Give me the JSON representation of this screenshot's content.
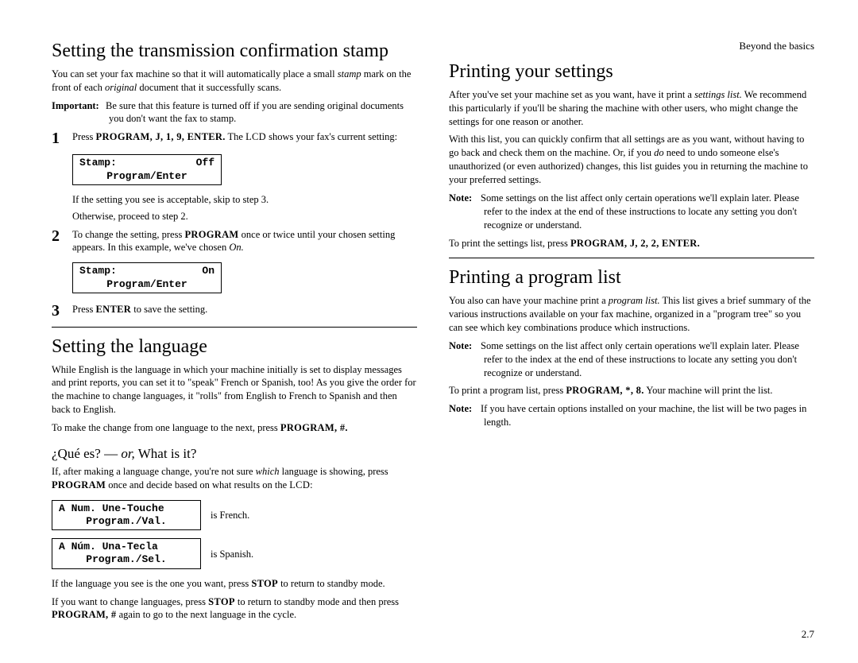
{
  "runningHead": "Beyond the basics",
  "pageNumber": "2.7",
  "left": {
    "h1a": "Setting the transmission confirmation stamp",
    "intro": {
      "pre": "You can set your fax machine so that it will automatically place a small ",
      "em": "stamp",
      "post1": " mark on the front of each ",
      "em2": "original",
      "post2": " document that it successfully scans."
    },
    "important": {
      "label": "Important:",
      "text": "Be sure that this feature is turned off if you are sending original documents you don't want the fax to stamp."
    },
    "step1": {
      "pre": "Press ",
      "keys": "PROGRAM, J, 1, 9, ENTER.",
      "mid": " The ",
      "lcd": "LCD",
      "post": " shows your fax's current setting:"
    },
    "lcd1": {
      "l1a": "Stamp:",
      "l1b": "Off",
      "l2": "Program/Enter"
    },
    "postLcd1a": "If the setting you see is acceptable, skip to step 3.",
    "postLcd1b": "Otherwise, proceed to step 2.",
    "step2": {
      "pre": "To change the setting, press ",
      "key": "PROGRAM",
      "mid": " once or twice until your chosen setting appears. In this example, we've chosen ",
      "em": "On.",
      "post": ""
    },
    "lcd2": {
      "l1a": "Stamp:",
      "l1b": "On",
      "l2": "Program/Enter"
    },
    "step3": {
      "pre": "Press ",
      "key": "ENTER",
      "post": " to save the setting."
    },
    "h1b": "Setting the language",
    "langIntro": "While English is the language in which your machine initially is set to display messages and print reports, you can set it to \"speak\" French or Spanish, too! As you give the order for the machine to change languages, it \"rolls\" from English to French to Spanish and then back to English.",
    "langMake": {
      "pre": "To make the change from one language to the next, press ",
      "key": "PROGRAM, #."
    },
    "h2": "¿Qué es? — ",
    "h2em": "or,",
    "h2post": " What is it?",
    "que1": {
      "pre": "If, after making a language change, you're not sure ",
      "em": "which",
      "mid": " language is showing, press ",
      "key": "PROGRAM",
      "post1": " once and decide based on what results on the ",
      "lcd": "LCD",
      "post2": ":"
    },
    "lcdFr": {
      "l1": "A Num. Une-Touche",
      "l2": "Program./Val."
    },
    "frIs": "is French.",
    "lcdEs": {
      "l1": "A Núm. Una-Tecla",
      "l2": "Program./Sel."
    },
    "esIs": "is Spanish.",
    "lang3": {
      "pre": "If the language you see is the one you want, press ",
      "key": "STOP",
      "post": " to return to standby mode."
    },
    "lang4": {
      "pre": "If you want to change languages, press ",
      "key1": "STOP",
      "mid": " to return to standby mode and then press ",
      "key2": "PROGRAM, #",
      "post": " again to go to the next language in the cycle."
    }
  },
  "right": {
    "h1a": "Printing your settings",
    "p1": {
      "pre": "After you've set your machine set as you want, have it print a ",
      "em": "settings list.",
      "post": " We recommend this particularly if you'll be sharing the machine with other users, who might change the settings for one reason or another."
    },
    "p2": {
      "pre": "With this list, you can quickly confirm that all settings are as you want, without having to go back and check them on the machine. Or, if you ",
      "em": "do",
      "post": " need to undo someone else's unauthorized (or even authorized) changes, this list guides you in returning the machine to your preferred settings."
    },
    "note1": {
      "label": "Note:",
      "text": "Some settings on the list affect only certain operations we'll explain later. Please refer to the index at the end of these instructions to locate any setting you don't recognize or understand."
    },
    "p3": {
      "pre": "To print the settings list, press ",
      "key": "PROGRAM, J, 2, 2, ENTER."
    },
    "h1b": "Printing a program list",
    "pl1": {
      "pre": "You also can have your machine print a ",
      "em": "program list.",
      "post": " This list gives a brief summary of the various instructions available on your fax machine, organized in a \"program tree\" so you can see which key combinations produce which instructions."
    },
    "note2": {
      "label": "Note:",
      "text": "Some settings on the list affect only certain operations we'll explain later. Please refer to the index at the end of these instructions to locate any setting you don't recognize or understand."
    },
    "pl2": {
      "pre": "To print a program list, press ",
      "key": "PROGRAM, *, 8.",
      "post": " Your machine will print the list."
    },
    "note3": {
      "label": "Note:",
      "text": "If you have certain options installed on your machine, the list will be two pages in length."
    }
  }
}
